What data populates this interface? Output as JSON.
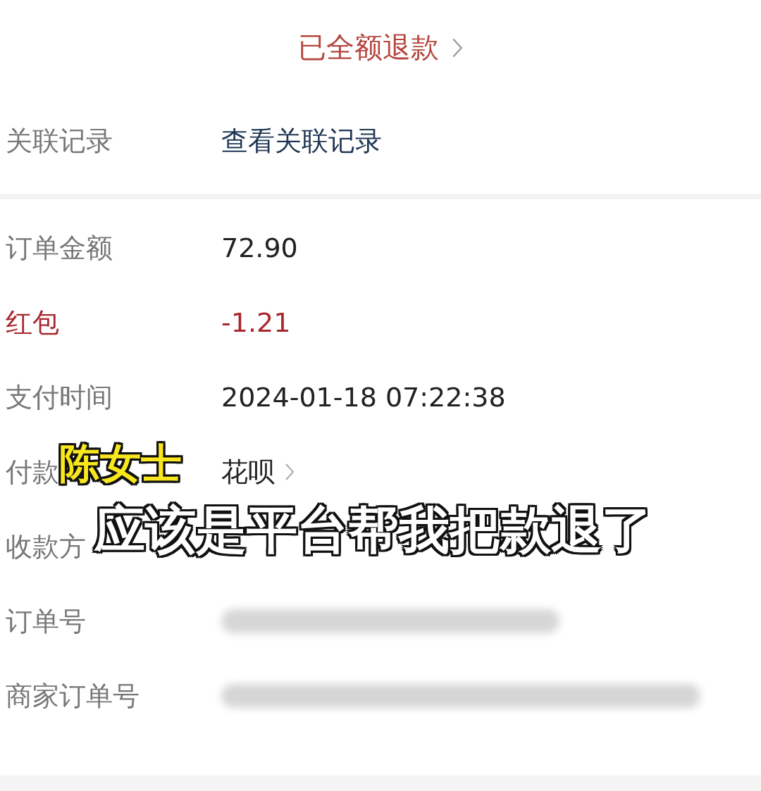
{
  "header": {
    "status": "已全额退款"
  },
  "link_row": {
    "label": "关联记录",
    "value": "查看关联记录"
  },
  "rows": [
    {
      "kind": "text",
      "label": "订单金额",
      "value": "72.90"
    },
    {
      "kind": "discount",
      "label": "红包",
      "value": "-1.21"
    },
    {
      "kind": "text",
      "label": "支付时间",
      "value": "2024-01-18 07:22:38"
    },
    {
      "kind": "method",
      "label": "付款",
      "value": "花呗"
    },
    {
      "kind": "hidden",
      "label": "收款方"
    },
    {
      "kind": "blurred",
      "label": "订单号"
    },
    {
      "kind": "blurred",
      "label": "商家订单号"
    }
  ],
  "captions": [
    {
      "kind": "speaker",
      "text": "陈女士"
    },
    {
      "kind": "subtitle",
      "text": "应该是平台帮我把款退了"
    }
  ]
}
